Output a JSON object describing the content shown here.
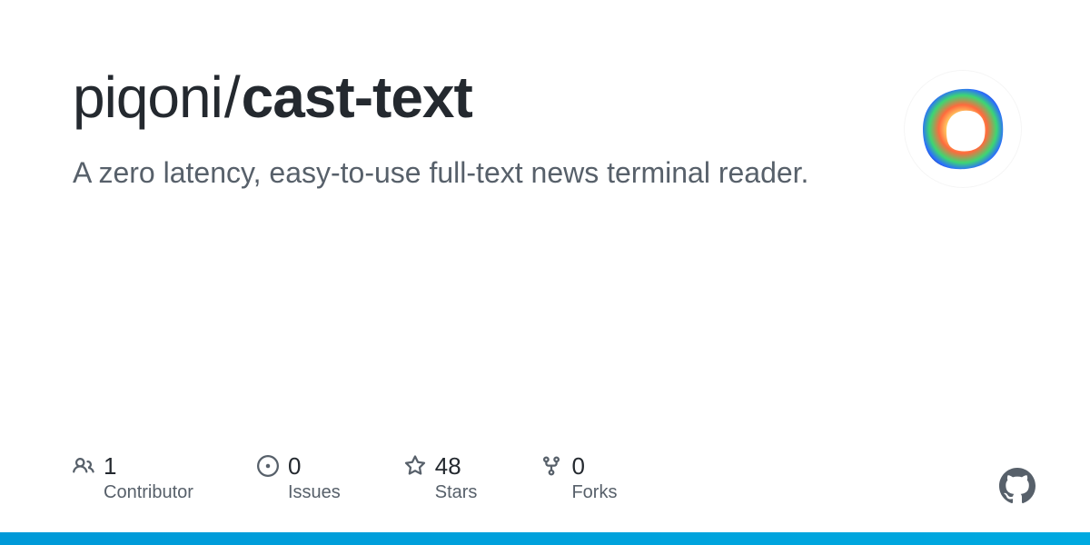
{
  "repo": {
    "owner": "piqoni",
    "separator": "/",
    "name": "cast-text",
    "description": "A zero latency, easy-to-use full-text news terminal reader."
  },
  "stats": {
    "contributors": {
      "count": "1",
      "label": "Contributor"
    },
    "issues": {
      "count": "0",
      "label": "Issues"
    },
    "stars": {
      "count": "48",
      "label": "Stars"
    },
    "forks": {
      "count": "0",
      "label": "Forks"
    }
  },
  "colors": {
    "accent_bar": "#00a9e0"
  }
}
